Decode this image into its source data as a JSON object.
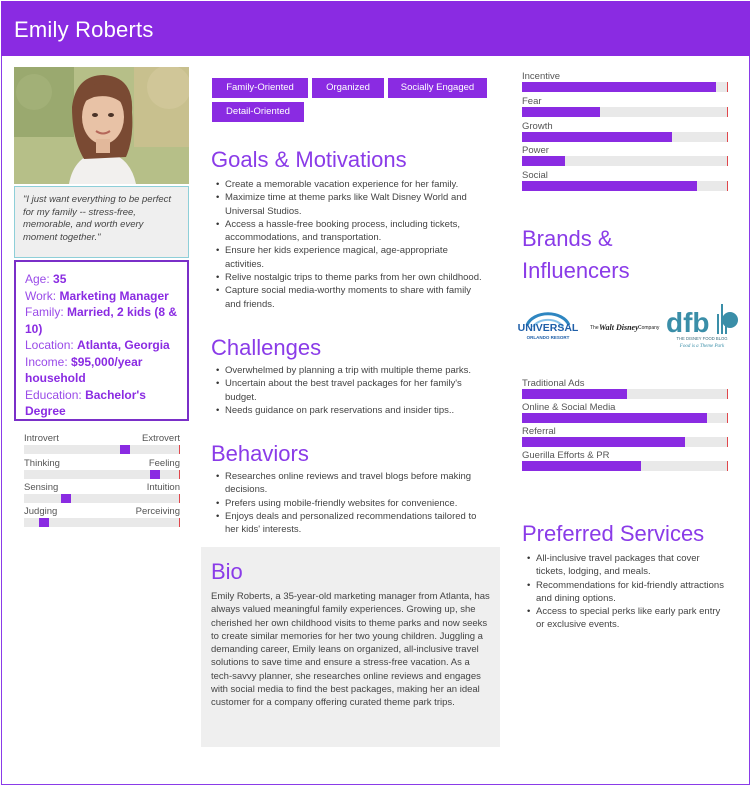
{
  "persona": {
    "name": "Emily Roberts"
  },
  "quote": "\"I just want everything to be perfect for my family -- stress-free, memorable, and worth every moment together.\"",
  "info": {
    "age_label": "Age:",
    "age": "35",
    "work_label": "Work:",
    "work": "Marketing Manager",
    "family_label": "Family:",
    "family": "Married, 2 kids (8 & 10)",
    "location_label": "Location:",
    "location": "Atlanta, Georgia",
    "income_label": "Income:",
    "income": "$95,000/year household",
    "education_label": "Education:",
    "education": "Bachelor's Degree"
  },
  "traits": [
    {
      "left": "Introvert",
      "right": "Extrovert",
      "value": 0.66
    },
    {
      "left": "Thinking",
      "right": "Feeling",
      "value": 0.86
    },
    {
      "left": "Sensing",
      "right": "Intuition",
      "value": 0.25
    },
    {
      "left": "Judging",
      "right": "Perceiving",
      "value": 0.1
    }
  ],
  "tags": [
    "Family-Oriented",
    "Organized",
    "Socially Engaged",
    "Detail-Oriented"
  ],
  "goals": {
    "title": "Goals & Motivations",
    "items": [
      "Create a memorable vacation experience for her family.",
      "Maximize time at theme parks like Walt Disney World and Universal Studios.",
      "Access a hassle-free booking process, including tickets, accommodations, and transportation.",
      "Ensure her kids experience magical, age-appropriate activities.",
      "Relive nostalgic trips to theme parks from her own childhood.",
      "Capture social media-worthy moments to share with family and friends."
    ]
  },
  "challenges": {
    "title": "Challenges",
    "items": [
      "Overwhelmed by planning a trip with multiple theme parks.",
      "Uncertain about the best travel packages for her family's budget.",
      "Needs guidance on park reservations and insider tips.."
    ]
  },
  "behaviors": {
    "title": "Behaviors",
    "items": [
      "Researches online reviews and travel blogs before making decisions.",
      "Prefers using mobile-friendly websites for convenience.",
      "Enjoys deals and personalized recommendations tailored to her kids' interests."
    ]
  },
  "bio": {
    "title": "Bio",
    "text": "Emily Roberts, a 35-year-old marketing manager from Atlanta, has always valued meaningful family experiences. Growing up, she cherished her own childhood visits to theme parks and now seeks to create similar memories for her two young children. Juggling a demanding career, Emily leans on organized, all-inclusive travel solutions to save time and ensure a stress-free vacation. As a tech-savvy planner, she researches online reviews and engages with social media to find the best packages, making her an ideal customer for a company offering curated theme park trips."
  },
  "motivations": [
    {
      "label": "Incentive",
      "value": 0.94
    },
    {
      "label": "Fear",
      "value": 0.38
    },
    {
      "label": "Growth",
      "value": 0.73
    },
    {
      "label": "Power",
      "value": 0.21
    },
    {
      "label": "Social",
      "value": 0.85
    }
  ],
  "brands": {
    "title": "Brands & Influencers",
    "logos": [
      {
        "icon": "universal-logo",
        "line1": "UNIVERSAL",
        "line2": "ORLANDO RESORT"
      },
      {
        "icon": "disney-logo",
        "prefix": "The",
        "name": "Walt Disney",
        "suffix": "Company"
      },
      {
        "icon": "dfb-logo",
        "name": "dfb",
        "sub": "THE DISNEY FOOD BLOG",
        "tagline": "Food is a Theme Park"
      }
    ]
  },
  "channels": [
    {
      "label": "Traditional Ads",
      "value": 0.51
    },
    {
      "label": "Online & Social Media",
      "value": 0.9
    },
    {
      "label": "Referral",
      "value": 0.79
    },
    {
      "label": "Guerilla Efforts & PR",
      "value": 0.58
    }
  ],
  "services": {
    "title": "Preferred Services",
    "items": [
      "All-inclusive travel packages that cover tickets, lodging, and meals.",
      "Recommendations for kid-friendly attractions and dining options.",
      "Access to special perks like early park entry or exclusive events."
    ]
  },
  "colors": {
    "accent": "#8a2be2",
    "track": "#e9e9e9",
    "end_marker": "#e0464b"
  }
}
